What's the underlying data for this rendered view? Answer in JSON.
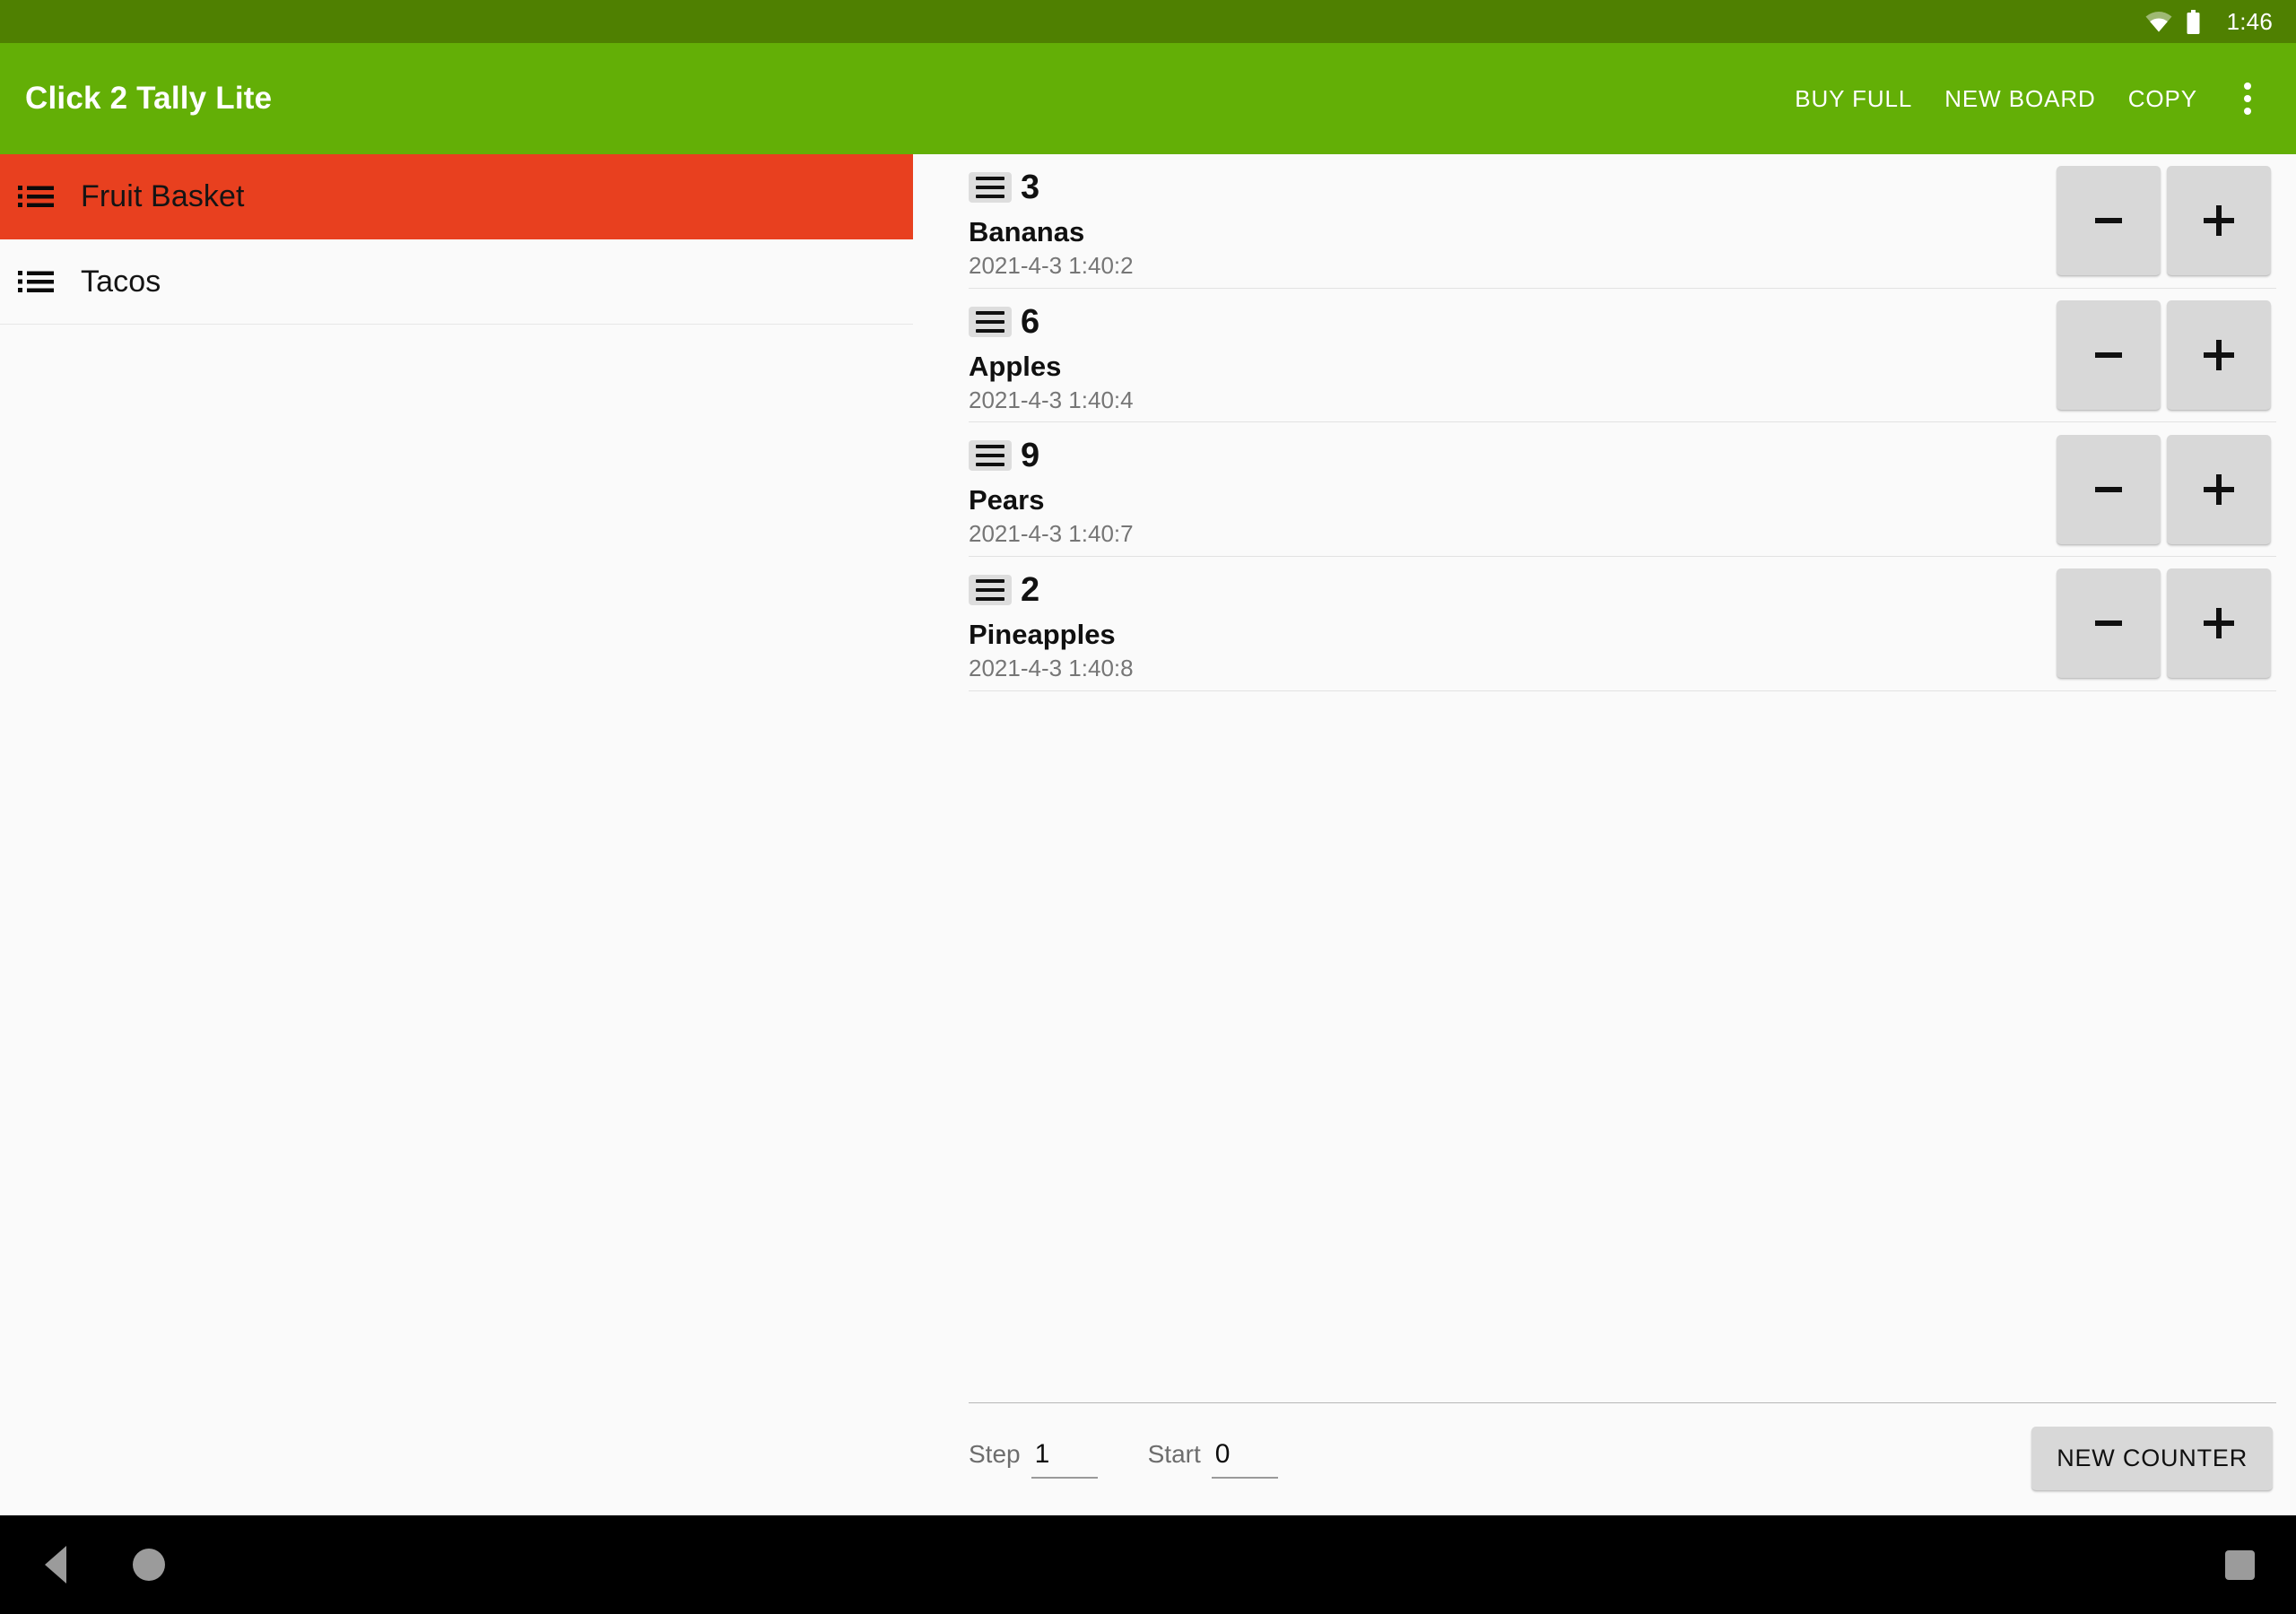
{
  "status_bar": {
    "time": "1:46",
    "wifi_icon": "wifi-icon",
    "battery_icon": "battery-icon",
    "background": "#4f8001"
  },
  "app_bar": {
    "title": "Click 2 Tally Lite",
    "background": "#63af06",
    "actions": [
      {
        "label": "BUY FULL",
        "name": "buy-full-button"
      },
      {
        "label": "NEW BOARD",
        "name": "new-board-button"
      },
      {
        "label": "COPY",
        "name": "copy-button"
      }
    ],
    "overflow_icon": "overflow-menu-icon"
  },
  "sidebar": {
    "selected_color": "#e8401f",
    "boards": [
      {
        "label": "Fruit Basket",
        "selected": true
      },
      {
        "label": "Tacos",
        "selected": false
      }
    ]
  },
  "counters": [
    {
      "count": "3",
      "name": "Bananas",
      "timestamp": "2021-4-3 1:40:2",
      "minus": "−",
      "plus": "+"
    },
    {
      "count": "6",
      "name": "Apples",
      "timestamp": "2021-4-3 1:40:4",
      "minus": "−",
      "plus": "+"
    },
    {
      "count": "9",
      "name": "Pears",
      "timestamp": "2021-4-3 1:40:7",
      "minus": "−",
      "plus": "+"
    },
    {
      "count": "2",
      "name": "Pineapples",
      "timestamp": "2021-4-3 1:40:8",
      "minus": "−",
      "plus": "+"
    }
  ],
  "footer": {
    "step_label": "Step",
    "step_value": "1",
    "start_label": "Start",
    "start_value": "0",
    "new_counter_label": "NEW COUNTER"
  },
  "nav_bar": {
    "back_icon": "back-triangle-icon",
    "home_icon": "home-circle-icon",
    "recents_icon": "recents-square-icon",
    "background": "#000000"
  }
}
